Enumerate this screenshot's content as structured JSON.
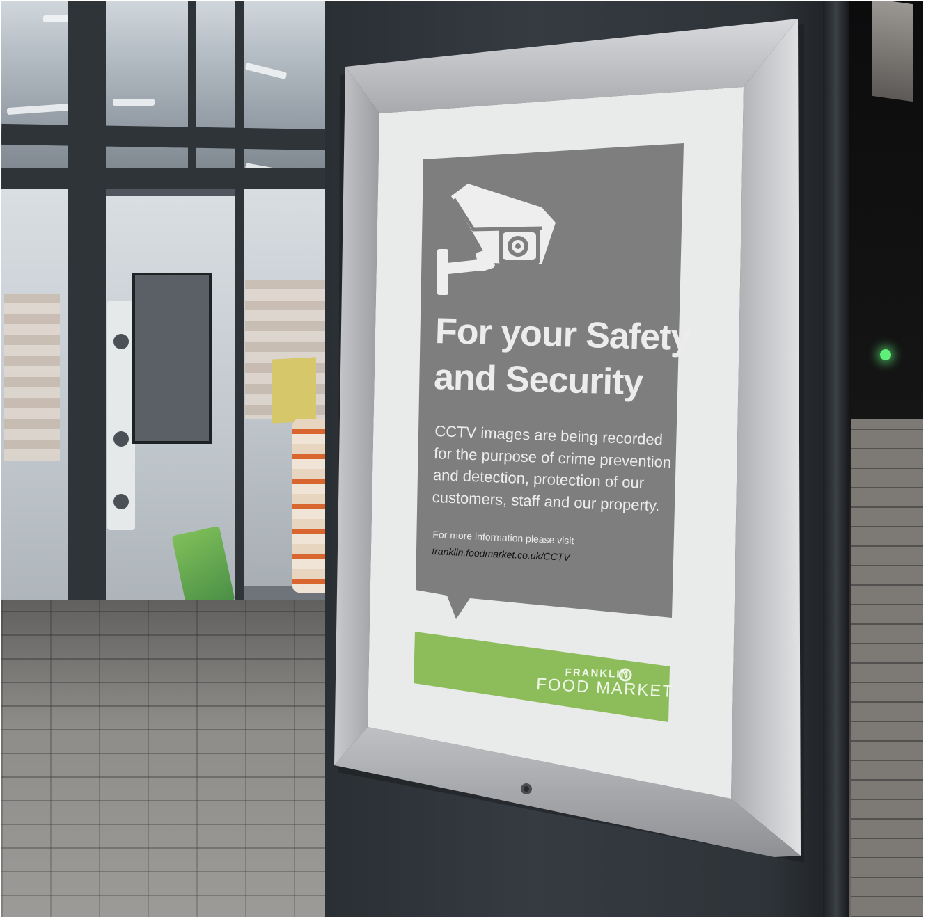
{
  "sign": {
    "headline_line1": "For your Safety",
    "headline_line2": "and Security",
    "body_lines": [
      "CCTV images are being recorded",
      "for the purpose of crime prevention",
      "and detection, protection of our",
      "customers, staff and our property."
    ],
    "more_info_line": "For more information please visit",
    "more_info_url": "franklin.foodmarket.co.uk/CCTV"
  },
  "brand": {
    "name_small": "FRANKLIN",
    "name_large": "FOOD MARKET"
  },
  "colors": {
    "poster_grey": "#7f7f80",
    "brand_green": "#8dbd5a",
    "frame_silver": "#b9babd",
    "pillar": "#30353a"
  },
  "icons": {
    "camera": "cctv-camera-icon",
    "logo": "franklin-logo-icon"
  }
}
